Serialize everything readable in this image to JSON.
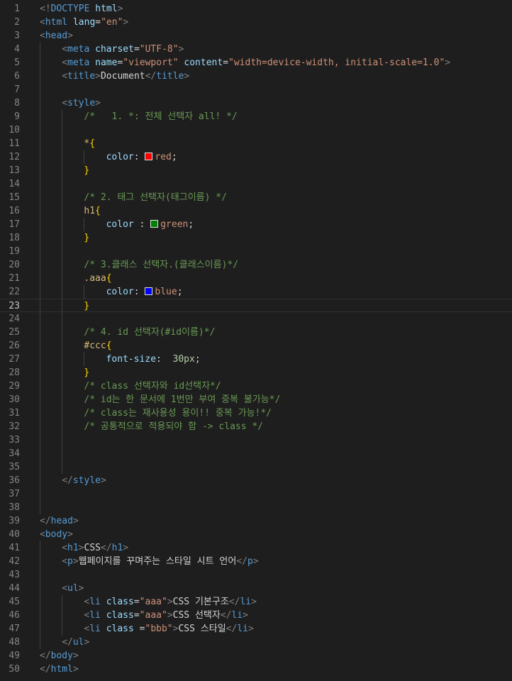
{
  "editor": {
    "language": "html",
    "current_line": 23,
    "colors": {
      "background": "#1e1e1e",
      "tag": "#569cd6",
      "attribute": "#9cdcfe",
      "string": "#ce9178",
      "comment": "#6a9955",
      "selector": "#d7ba7d",
      "brace": "#ffd700"
    },
    "lines": [
      {
        "n": 1,
        "indent": 0,
        "tokens": [
          [
            "punc",
            "<!"
          ],
          [
            "tag",
            "DOCTYPE"
          ],
          [
            "text",
            " "
          ],
          [
            "attr",
            "html"
          ],
          [
            "punc",
            ">"
          ]
        ]
      },
      {
        "n": 2,
        "indent": 0,
        "tokens": [
          [
            "punc",
            "<"
          ],
          [
            "tag",
            "html"
          ],
          [
            "text",
            " "
          ],
          [
            "attr",
            "lang"
          ],
          [
            "text",
            "="
          ],
          [
            "str",
            "\"en\""
          ],
          [
            "punc",
            ">"
          ]
        ]
      },
      {
        "n": 3,
        "indent": 0,
        "tokens": [
          [
            "punc",
            "<"
          ],
          [
            "tag",
            "head"
          ],
          [
            "punc",
            ">"
          ]
        ]
      },
      {
        "n": 4,
        "indent": 4,
        "tokens": [
          [
            "punc",
            "<"
          ],
          [
            "tag",
            "meta"
          ],
          [
            "text",
            " "
          ],
          [
            "attr",
            "charset"
          ],
          [
            "text",
            "="
          ],
          [
            "str",
            "\"UTF-8\""
          ],
          [
            "punc",
            ">"
          ]
        ]
      },
      {
        "n": 5,
        "indent": 4,
        "tokens": [
          [
            "punc",
            "<"
          ],
          [
            "tag",
            "meta"
          ],
          [
            "text",
            " "
          ],
          [
            "attr",
            "name"
          ],
          [
            "text",
            "="
          ],
          [
            "str",
            "\"viewport\""
          ],
          [
            "text",
            " "
          ],
          [
            "attr",
            "content"
          ],
          [
            "text",
            "="
          ],
          [
            "str",
            "\"width=device-width, initial-scale=1.0\""
          ],
          [
            "punc",
            ">"
          ]
        ]
      },
      {
        "n": 6,
        "indent": 4,
        "tokens": [
          [
            "punc",
            "<"
          ],
          [
            "tag",
            "title"
          ],
          [
            "punc",
            ">"
          ],
          [
            "text",
            "Document"
          ],
          [
            "punc",
            "</"
          ],
          [
            "tag",
            "title"
          ],
          [
            "punc",
            ">"
          ]
        ]
      },
      {
        "n": 7,
        "indent": 0,
        "tokens": []
      },
      {
        "n": 8,
        "indent": 4,
        "tokens": [
          [
            "punc",
            "<"
          ],
          [
            "tag",
            "style"
          ],
          [
            "punc",
            ">"
          ]
        ]
      },
      {
        "n": 9,
        "indent": 8,
        "tokens": [
          [
            "com",
            "/*   1. *: 전체 선택자 all! */"
          ]
        ]
      },
      {
        "n": 10,
        "indent": 0,
        "tokens": []
      },
      {
        "n": 11,
        "indent": 8,
        "tokens": [
          [
            "sel",
            "*"
          ],
          [
            "brace",
            "{"
          ]
        ]
      },
      {
        "n": 12,
        "indent": 12,
        "tokens": [
          [
            "prop",
            "color"
          ],
          [
            "text",
            ": "
          ],
          [
            "swatch",
            "#ff0000"
          ],
          [
            "str",
            "red"
          ],
          [
            "text",
            ";"
          ]
        ]
      },
      {
        "n": 13,
        "indent": 8,
        "tokens": [
          [
            "brace",
            "}"
          ]
        ]
      },
      {
        "n": 14,
        "indent": 0,
        "tokens": []
      },
      {
        "n": 15,
        "indent": 8,
        "tokens": [
          [
            "com",
            "/* 2. 태그 선택자(태그이름) */"
          ]
        ]
      },
      {
        "n": 16,
        "indent": 8,
        "tokens": [
          [
            "sel",
            "h1"
          ],
          [
            "brace",
            "{"
          ]
        ]
      },
      {
        "n": 17,
        "indent": 12,
        "tokens": [
          [
            "prop",
            "color"
          ],
          [
            "text",
            " : "
          ],
          [
            "swatch",
            "#008000"
          ],
          [
            "str",
            "green"
          ],
          [
            "text",
            ";"
          ]
        ]
      },
      {
        "n": 18,
        "indent": 8,
        "tokens": [
          [
            "brace",
            "}"
          ]
        ]
      },
      {
        "n": 19,
        "indent": 0,
        "tokens": []
      },
      {
        "n": 20,
        "indent": 8,
        "tokens": [
          [
            "com",
            "/* 3.클래스 선택자.(클래스이름)*/"
          ]
        ]
      },
      {
        "n": 21,
        "indent": 8,
        "tokens": [
          [
            "sel",
            ".aaa"
          ],
          [
            "brace",
            "{"
          ]
        ]
      },
      {
        "n": 22,
        "indent": 12,
        "tokens": [
          [
            "prop",
            "color"
          ],
          [
            "text",
            ": "
          ],
          [
            "swatch",
            "#0000ff"
          ],
          [
            "str",
            "blue"
          ],
          [
            "text",
            ";"
          ]
        ]
      },
      {
        "n": 23,
        "indent": 8,
        "tokens": [
          [
            "brace",
            "}"
          ]
        ]
      },
      {
        "n": 24,
        "indent": 0,
        "tokens": []
      },
      {
        "n": 25,
        "indent": 8,
        "tokens": [
          [
            "com",
            "/* 4. id 선택자(#id이름)*/"
          ]
        ]
      },
      {
        "n": 26,
        "indent": 8,
        "tokens": [
          [
            "sel",
            "#ccc"
          ],
          [
            "brace",
            "{"
          ]
        ]
      },
      {
        "n": 27,
        "indent": 12,
        "tokens": [
          [
            "prop",
            "font-size"
          ],
          [
            "text",
            ":  "
          ],
          [
            "num",
            "30px"
          ],
          [
            "text",
            ";"
          ]
        ]
      },
      {
        "n": 28,
        "indent": 8,
        "tokens": [
          [
            "brace",
            "}"
          ]
        ]
      },
      {
        "n": 29,
        "indent": 8,
        "tokens": [
          [
            "com",
            "/* class 선택자와 id선택자*/"
          ]
        ]
      },
      {
        "n": 30,
        "indent": 8,
        "tokens": [
          [
            "com",
            "/* id는 한 문서에 1번만 부여 중복 불가능*/"
          ]
        ]
      },
      {
        "n": 31,
        "indent": 8,
        "tokens": [
          [
            "com",
            "/* class는 재사용성 용이!! 중복 가능!*/"
          ]
        ]
      },
      {
        "n": 32,
        "indent": 8,
        "tokens": [
          [
            "com",
            "/* 공통적으로 적용되야 함 -> class */"
          ]
        ]
      },
      {
        "n": 33,
        "indent": 0,
        "tokens": []
      },
      {
        "n": 34,
        "indent": 0,
        "tokens": []
      },
      {
        "n": 35,
        "indent": 0,
        "tokens": []
      },
      {
        "n": 36,
        "indent": 4,
        "tokens": [
          [
            "punc",
            "</"
          ],
          [
            "tag",
            "style"
          ],
          [
            "punc",
            ">"
          ]
        ]
      },
      {
        "n": 37,
        "indent": 0,
        "tokens": []
      },
      {
        "n": 38,
        "indent": 0,
        "tokens": []
      },
      {
        "n": 39,
        "indent": 0,
        "tokens": [
          [
            "punc",
            "</"
          ],
          [
            "tag",
            "head"
          ],
          [
            "punc",
            ">"
          ]
        ]
      },
      {
        "n": 40,
        "indent": 0,
        "tokens": [
          [
            "punc",
            "<"
          ],
          [
            "tag",
            "body"
          ],
          [
            "punc",
            ">"
          ]
        ]
      },
      {
        "n": 41,
        "indent": 4,
        "tokens": [
          [
            "punc",
            "<"
          ],
          [
            "tag",
            "h1"
          ],
          [
            "punc",
            ">"
          ],
          [
            "text",
            "CSS"
          ],
          [
            "punc",
            "</"
          ],
          [
            "tag",
            "h1"
          ],
          [
            "punc",
            ">"
          ]
        ]
      },
      {
        "n": 42,
        "indent": 4,
        "tokens": [
          [
            "punc",
            "<"
          ],
          [
            "tag",
            "p"
          ],
          [
            "punc",
            ">"
          ],
          [
            "text",
            "웹페이지를 꾸며주는 스타일 시트 언어"
          ],
          [
            "punc",
            "</"
          ],
          [
            "tag",
            "p"
          ],
          [
            "punc",
            ">"
          ]
        ]
      },
      {
        "n": 43,
        "indent": 0,
        "tokens": []
      },
      {
        "n": 44,
        "indent": 4,
        "tokens": [
          [
            "punc",
            "<"
          ],
          [
            "tag",
            "ul"
          ],
          [
            "punc",
            ">"
          ]
        ]
      },
      {
        "n": 45,
        "indent": 8,
        "tokens": [
          [
            "punc",
            "<"
          ],
          [
            "tag",
            "li"
          ],
          [
            "text",
            " "
          ],
          [
            "attr",
            "class"
          ],
          [
            "text",
            "="
          ],
          [
            "str",
            "\"aaa\""
          ],
          [
            "punc",
            ">"
          ],
          [
            "text",
            "CSS 기본구조"
          ],
          [
            "punc",
            "</"
          ],
          [
            "tag",
            "li"
          ],
          [
            "punc",
            ">"
          ]
        ]
      },
      {
        "n": 46,
        "indent": 8,
        "tokens": [
          [
            "punc",
            "<"
          ],
          [
            "tag",
            "li"
          ],
          [
            "text",
            " "
          ],
          [
            "attr",
            "class"
          ],
          [
            "text",
            "="
          ],
          [
            "str",
            "\"aaa\""
          ],
          [
            "punc",
            ">"
          ],
          [
            "text",
            "CSS 선택자"
          ],
          [
            "punc",
            "</"
          ],
          [
            "tag",
            "li"
          ],
          [
            "punc",
            ">"
          ]
        ]
      },
      {
        "n": 47,
        "indent": 8,
        "tokens": [
          [
            "punc",
            "<"
          ],
          [
            "tag",
            "li"
          ],
          [
            "text",
            " "
          ],
          [
            "attr",
            "class"
          ],
          [
            "text",
            " ="
          ],
          [
            "str",
            "\"bbb\""
          ],
          [
            "punc",
            ">"
          ],
          [
            "text",
            "CSS 스타일"
          ],
          [
            "punc",
            "</"
          ],
          [
            "tag",
            "li"
          ],
          [
            "punc",
            ">"
          ]
        ]
      },
      {
        "n": 48,
        "indent": 4,
        "tokens": [
          [
            "punc",
            "</"
          ],
          [
            "tag",
            "ul"
          ],
          [
            "punc",
            ">"
          ]
        ]
      },
      {
        "n": 49,
        "indent": 0,
        "tokens": [
          [
            "punc",
            "</"
          ],
          [
            "tag",
            "body"
          ],
          [
            "punc",
            ">"
          ]
        ]
      },
      {
        "n": 50,
        "indent": 0,
        "tokens": [
          [
            "punc",
            "</"
          ],
          [
            "tag",
            "html"
          ],
          [
            "punc",
            ">"
          ]
        ]
      }
    ]
  }
}
